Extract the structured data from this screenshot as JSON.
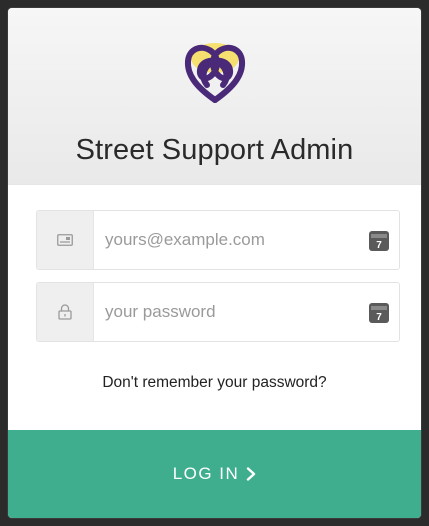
{
  "header": {
    "title": "Street Support Admin",
    "logo_icon": "heart-knot-logo"
  },
  "form": {
    "email": {
      "placeholder": "yours@example.com",
      "value": "",
      "icon": "id-card-icon"
    },
    "password": {
      "placeholder": "your password",
      "value": "",
      "icon": "lock-icon"
    },
    "password_manager_icon": "password-manager-icon",
    "forgot_label": "Don't remember your password?",
    "login_label": "LOG IN",
    "login_icon": "chevron-right-icon"
  },
  "colors": {
    "brand_purple": "#4a2a78",
    "brand_yellow": "#f5e070",
    "accent_green": "#3fae8e"
  }
}
